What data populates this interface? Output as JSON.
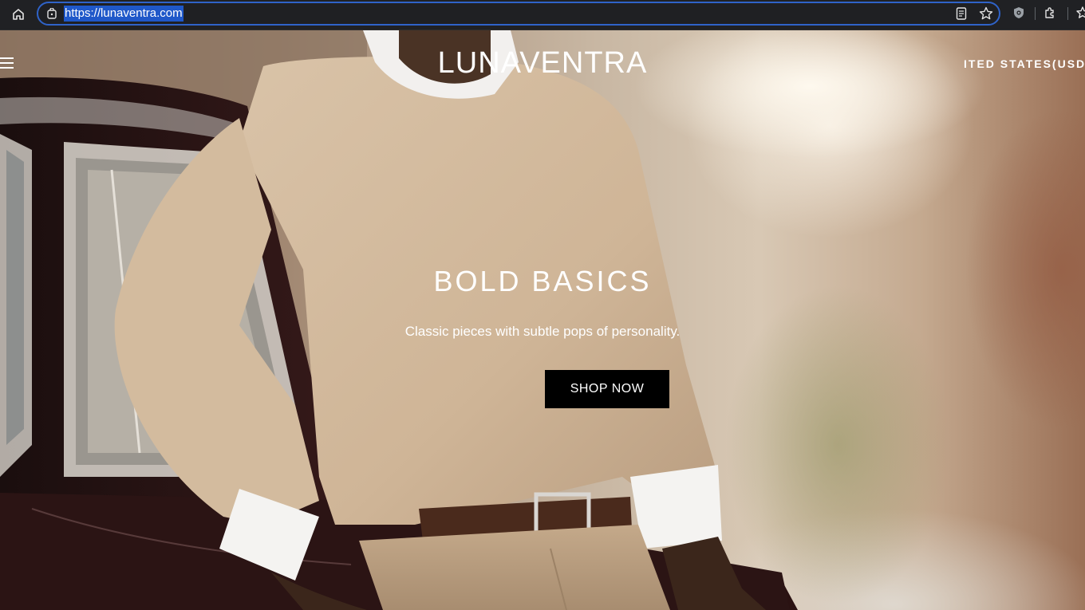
{
  "browser": {
    "url": "https://lunaventra.com",
    "icons": [
      "home-icon",
      "page-info-icon",
      "reader-mode-icon",
      "bookmark-star-icon",
      "shield-extension-icon",
      "extensions-puzzle-icon",
      "favorites-icon"
    ]
  },
  "site": {
    "brand": "LUNAVENTRA",
    "country_selector": "ITED STATES(USD",
    "menu_icon": "hamburger-menu-icon"
  },
  "hero": {
    "headline": "BOLD BASICS",
    "subline": "Classic pieces with subtle pops of personality.",
    "cta_label": "SHOP NOW"
  },
  "colors": {
    "address_focus": "#2f63c9",
    "url_highlight": "#1f58c9",
    "cta_background": "#000000",
    "text_on_hero": "#ffffff"
  }
}
